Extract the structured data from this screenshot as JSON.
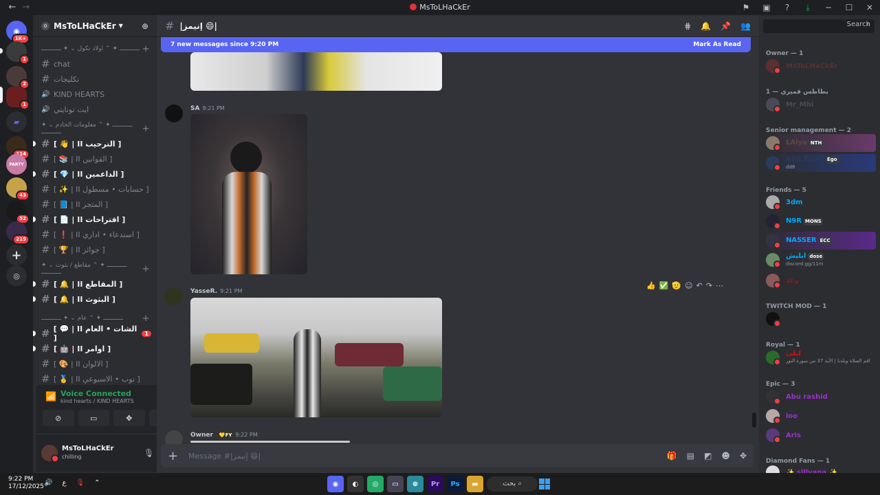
{
  "window": {
    "title": "MsToLHaCkEr",
    "back": "←",
    "forward": "→"
  },
  "servers": {
    "badges": [
      "1K+",
      "1",
      "2",
      "1",
      "114",
      "43",
      "52",
      "215"
    ],
    "party_label": "PARTY"
  },
  "channels": {
    "guild_name": "MsToLHaCkEr",
    "categories": [
      {
        "label": "ـــــــــــ ✦ ⌃ اولاد نكول ⌄ ✦ ـــــــــــ",
        "items": [
          {
            "name": "chat",
            "type": "text",
            "unread": false
          },
          {
            "name": "تكليجات",
            "type": "text",
            "unread": false
          },
          {
            "name": "KIND HEARTS",
            "type": "voice",
            "unread": false
          },
          {
            "name": "ايت تونايتي",
            "type": "voice",
            "unread": false
          }
        ]
      },
      {
        "label": "ـــــــــــ ✦ ⌃ معلومات الخادم ⌄ ✦ ـــــــــــ",
        "items": [
          {
            "name": "[ 👋 | II الترحيب ]",
            "unread": true
          },
          {
            "name": "[ 📚 | II القوانين ]",
            "unread": false
          },
          {
            "name": "[ 💎 | II الداعمين ]",
            "unread": true
          },
          {
            "name": "[ ✨ | II حسابات • مسطول ]",
            "unread": false
          },
          {
            "name": "[ 📘 | II المتجر ]",
            "unread": false
          },
          {
            "name": "[ 📄 | II اقتراحات ]",
            "unread": true
          },
          {
            "name": "[ ❗ | II استدعاء • اداري ]",
            "unread": false
          },
          {
            "name": "[ 🏆 | II جوائز ]",
            "unread": false
          }
        ]
      },
      {
        "label": "ـــــــــــ ✦ ⌃ مقاطع / بثوث ⌄ ✦ ـــــــــــ",
        "items": [
          {
            "name": "[ 🔔 | II المقاطع ]",
            "unread": true
          },
          {
            "name": "[ 🔔 | II البثوث ]",
            "unread": true
          }
        ]
      },
      {
        "label": "ـــــــــــ ✦ ⌃ عام ⌄ ✦ ـــــــــــ",
        "items": [
          {
            "name": "[ 💬 | II الشات • العام ]",
            "unread": true,
            "badge": "1"
          },
          {
            "name": "[ 🤖 | II اوامر ]",
            "unread": true
          },
          {
            "name": "[ 🎨 | II الالوان ]",
            "unread": false
          },
          {
            "name": "[ 🥇 | II توب • الاسبوعي ]",
            "unread": false
          }
        ]
      }
    ]
  },
  "voice": {
    "status": "Voice Connected",
    "location": "kind hearts / KIND HEARTS"
  },
  "user": {
    "name": "MsToLHaCkEr",
    "status": "chilling"
  },
  "chat": {
    "channel_title": "|إنيمز 😄|",
    "new_messages": "7 new messages since 9:20 PM",
    "mark_read": "Mark As Read",
    "messages": [
      {
        "author": "SA",
        "time": "9:21 PM"
      },
      {
        "author": "YasseR.",
        "time": "9:21 PM"
      },
      {
        "author": "Owner",
        "tag": "💛FY",
        "time": "9:22 PM"
      }
    ],
    "reactions": [
      "👍",
      "✅",
      "🫡"
    ],
    "composer_placeholder": "Message #|إنيمز 😄|"
  },
  "members": {
    "search_placeholder": "Search",
    "groups": [
      {
        "label": "Owner — 1",
        "members": [
          {
            "name": "MsToLHaCkEr",
            "color": "#5a3030"
          }
        ]
      },
      {
        "label": "بطاطس قميري — 1",
        "members": [
          {
            "name": "Mr_Mhi",
            "color": "#4a4a55"
          }
        ]
      },
      {
        "label": "Senior management — 2",
        "members": [
          {
            "name": "ŁAlya",
            "tag": "NTH",
            "color": "#5c4a3a"
          },
          {
            "name": "Abu Zharl",
            "tag": "Ego",
            "sub": "dd8",
            "color": "#2a3b5c"
          }
        ]
      },
      {
        "label": "Friends — 5",
        "members": [
          {
            "name": "3dm",
            "color": "#00a8fc"
          },
          {
            "name": "N9R",
            "tag": "MONS",
            "color": "#00a8fc"
          },
          {
            "name": "NASSER",
            "tag": "ECC",
            "color": "#00a8fc"
          },
          {
            "name": "ابليش",
            "tag": "dose",
            "sub": "discord.gg/11m",
            "color": "#00a8fc"
          },
          {
            "name": "وعد",
            "color": "#8b1c1c"
          }
        ]
      },
      {
        "label": "TWITCH MOD — 1",
        "members": [
          {
            "name": "",
            "color": "#dbdee1"
          }
        ]
      },
      {
        "label": "Royal — 1",
        "members": [
          {
            "name": "ليلى",
            "sub": "اقم الصلاة وبلدنا | الآية 37 من سورة النور",
            "color": "#d10f0f"
          }
        ]
      },
      {
        "label": "Epic — 3",
        "members": [
          {
            "name": "Abu rashid",
            "color": "#9b30d0"
          },
          {
            "name": "loo",
            "color": "#9b30d0"
          },
          {
            "name": "Aris",
            "color": "#9b30d0"
          }
        ]
      },
      {
        "label": "Diamond Fans — 1",
        "members": [
          {
            "name": "✨ sillvana ✨",
            "color": "#9b30d0"
          }
        ]
      }
    ]
  },
  "taskbar": {
    "time": "9:22 PM",
    "date": "17/12/2025",
    "search": "بحث",
    "lang": "ع"
  }
}
